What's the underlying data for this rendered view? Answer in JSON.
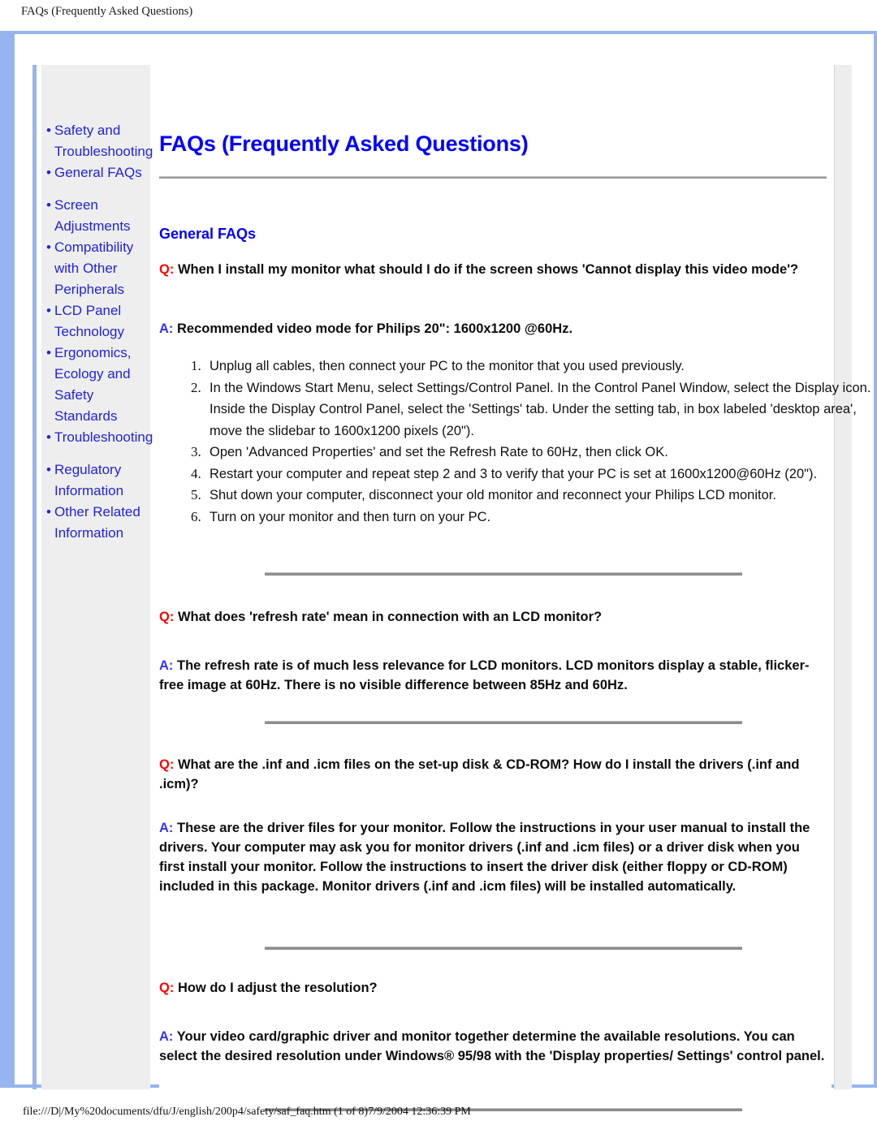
{
  "page_header": "FAQs (Frequently Asked Questions)",
  "document": {
    "title": "FAQs (Frequently Asked Questions)",
    "section_title": "General FAQs"
  },
  "sidebar": {
    "groups": [
      {
        "items": [
          {
            "label": "Safety and Troubleshooting"
          },
          {
            "label": "General FAQs"
          }
        ]
      },
      {
        "items": [
          {
            "label": "Screen Adjustments"
          },
          {
            "label": "Compatibility with Other Peripherals"
          },
          {
            "label": "LCD Panel Technology"
          },
          {
            "label": "Ergonomics, Ecology and Safety Standards"
          },
          {
            "label": "Troubleshooting"
          }
        ]
      },
      {
        "items": [
          {
            "label": "Regulatory Information"
          },
          {
            "label": "Other Related Information"
          }
        ]
      }
    ]
  },
  "labels": {
    "q_tag": "Q:",
    "a_tag": "A:"
  },
  "faqs": [
    {
      "question": "When I install my monitor what should I do if the screen shows 'Cannot display this video mode'?",
      "answer": "Recommended video mode for Philips 20\": 1600x1200 @60Hz.",
      "steps": [
        "Unplug all cables, then connect your PC to the monitor that you used previously.",
        "In the Windows Start Menu, select Settings/Control Panel. In the Control Panel Window, select the Display icon. Inside the Display Control Panel, select the 'Settings' tab. Under the setting tab, in box labeled 'desktop area', move the slidebar to 1600x1200 pixels (20\").",
        "Open 'Advanced Properties' and set the Refresh Rate to 60Hz, then click OK.",
        "Restart your computer and repeat step 2 and 3 to verify that your PC is set at 1600x1200@60Hz (20\").",
        "Shut down your computer, disconnect your old monitor and reconnect your Philips LCD monitor.",
        "Turn on your monitor and then turn on your PC."
      ]
    },
    {
      "question": "What does 'refresh rate' mean in connection with an LCD monitor?",
      "answer": "The refresh rate is of much less relevance for LCD monitors. LCD monitors display a stable, flicker-free image at 60Hz. There is no visible difference between 85Hz and 60Hz."
    },
    {
      "question": "What are the .inf and .icm files on the set-up disk & CD-ROM? How do I install the drivers (.inf and .icm)?",
      "answer": "These are the driver files for your monitor. Follow the instructions in your user manual to install the drivers. Your computer may ask you for monitor drivers (.inf and .icm files) or a driver disk when you first install your monitor. Follow the instructions to insert the driver disk (either floppy or CD-ROM) included in this package. Monitor drivers (.inf and .icm files) will be installed automatically."
    },
    {
      "question": "How do I adjust the resolution?",
      "answer": "Your video card/graphic driver and monitor together determine the available resolutions. You can select the desired resolution under Windows® 95/98 with the 'Display properties/ Settings' control panel."
    }
  ],
  "footer": "file:///D|/My%20documents/dfu/J/english/200p4/safety/saf_faq.htm (1 of 8)7/9/2004 12:36:39 PM",
  "colors": {
    "frame_blue": "#96b4f0",
    "link_blue": "#2222dd",
    "title_blue": "#0000ff",
    "q_red": "#ff0000",
    "a_blue": "#3333ff",
    "sidebar_grey": "#eeeeee",
    "rule_grey": "#8c8c8c"
  }
}
